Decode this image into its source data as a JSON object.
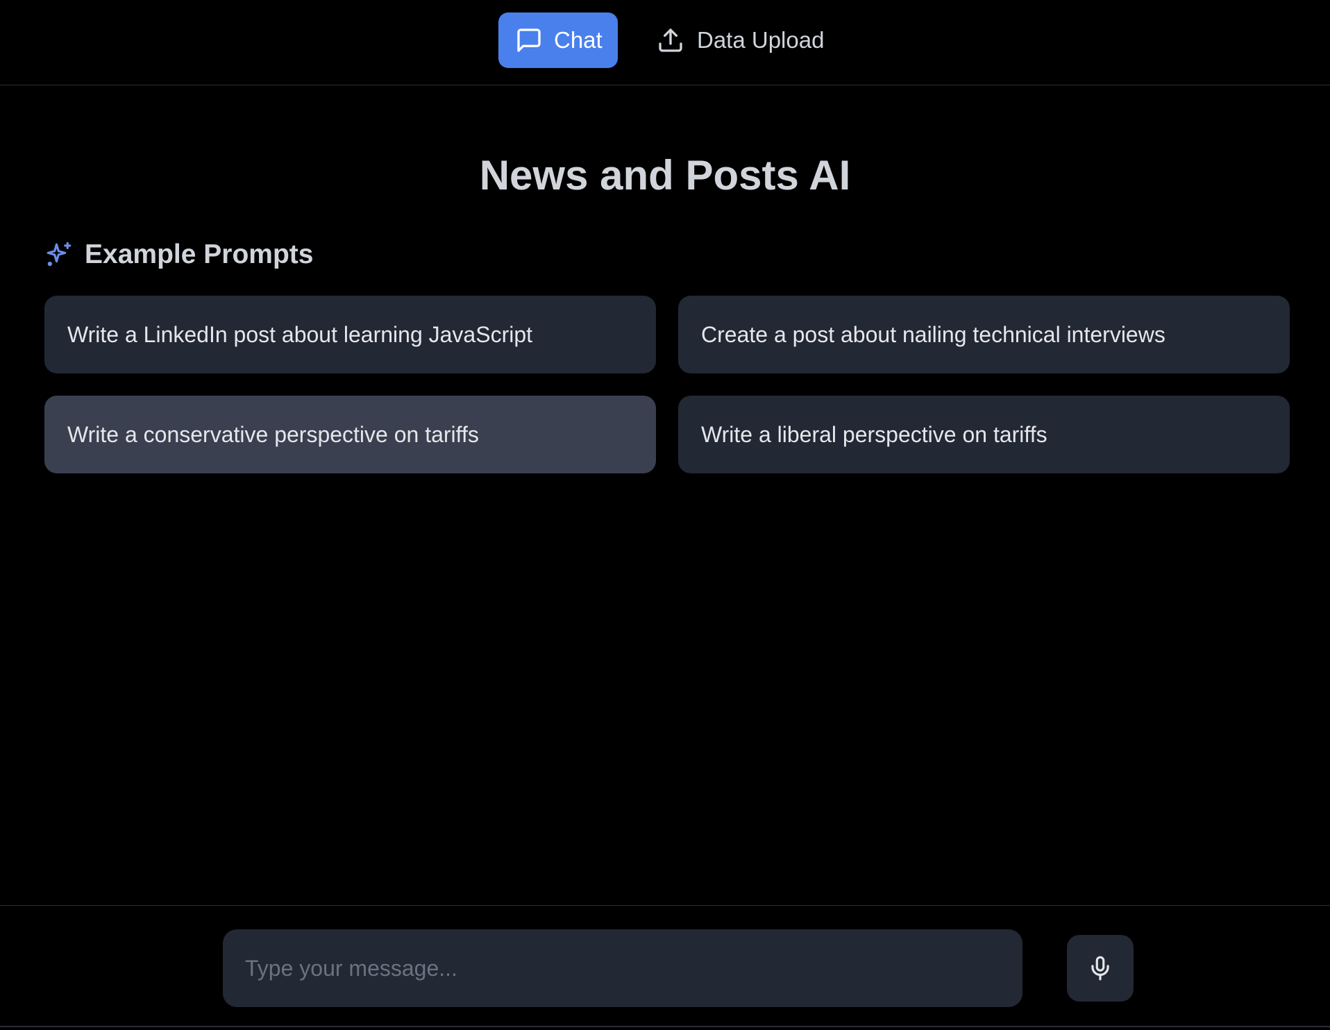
{
  "nav": {
    "tabs": [
      {
        "label": "Chat",
        "icon": "message-square-icon",
        "active": true
      },
      {
        "label": "Data Upload",
        "icon": "upload-icon",
        "active": false
      }
    ]
  },
  "main": {
    "title": "News and Posts AI",
    "examples": {
      "heading": "Example Prompts",
      "icon": "sparkles-icon",
      "prompts": [
        {
          "label": "Write a LinkedIn post about learning JavaScript"
        },
        {
          "label": "Create a post about nailing technical interviews"
        },
        {
          "label": "Write a conservative perspective on tariffs"
        },
        {
          "label": "Write a liberal perspective on tariffs"
        }
      ]
    }
  },
  "composer": {
    "placeholder": "Type your message...",
    "value": "",
    "mic_icon": "microphone-icon"
  },
  "colors": {
    "background": "#000000",
    "accent": "#4a80ec",
    "card": "#222834",
    "card_hover": "#3a4050",
    "text": "#d1d5db",
    "placeholder": "#6b7280"
  }
}
